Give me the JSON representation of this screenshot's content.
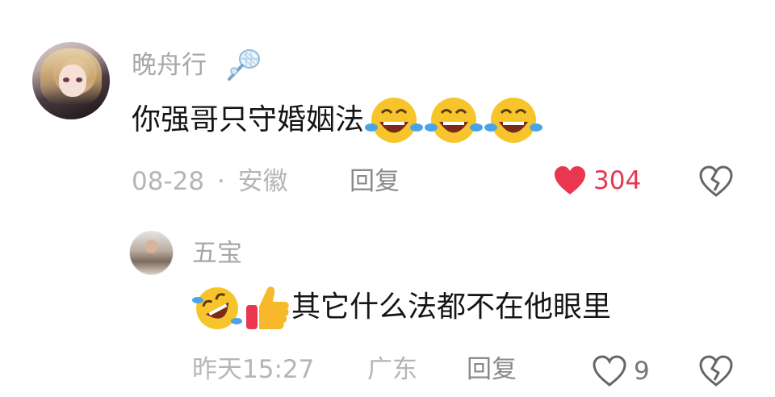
{
  "comment": {
    "username": "晚舟行",
    "badge_icon": "badminton-racket-icon",
    "text": "你强哥只守婚姻法",
    "trailing_emojis": [
      "tears-of-joy-emoji",
      "tears-of-joy-emoji",
      "tears-of-joy-emoji"
    ],
    "date": "08-28",
    "separator": "·",
    "location": "安徽",
    "reply_label": "回复",
    "likes": "304",
    "liked": true,
    "like_color": "#e8374f"
  },
  "reply": {
    "username": "五宝",
    "leading_emojis": [
      "rolling-laughing-emoji",
      "thumbs-up-emoji"
    ],
    "text": "其它什么法都不在他眼里",
    "time": "昨天15:27",
    "location": "广东",
    "reply_label": "回复",
    "likes": "9",
    "liked": false
  },
  "colors": {
    "meta_gray": "#b5b5b5",
    "name_gray": "#a7a7a7",
    "text": "#151515"
  }
}
